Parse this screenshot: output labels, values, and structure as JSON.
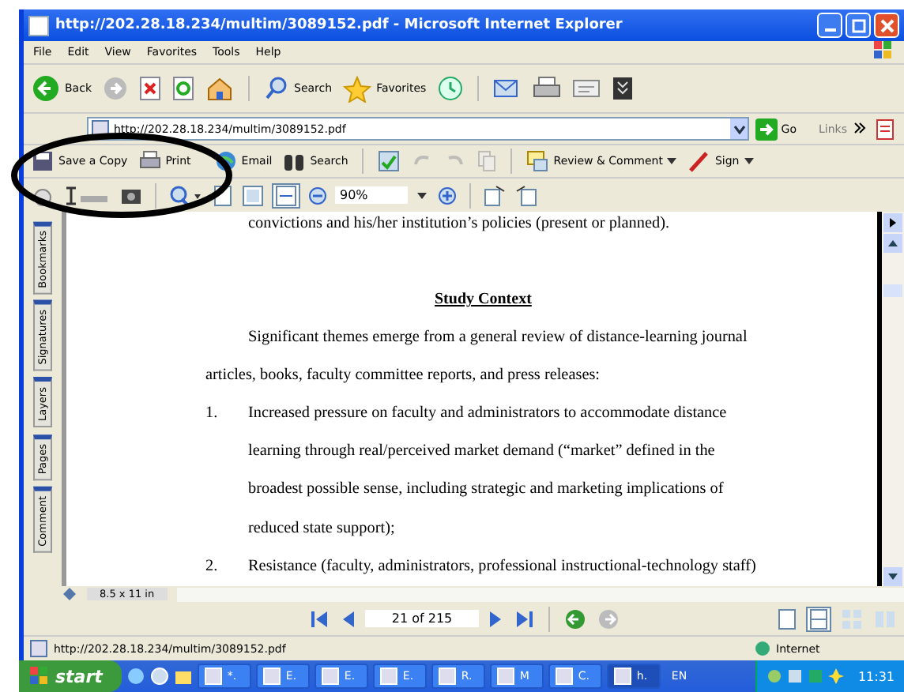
{
  "window": {
    "title": "http://202.28.18.234/multim/3089152.pdf - Microsoft Internet Explorer"
  },
  "menu": [
    "File",
    "Edit",
    "View",
    "Favorites",
    "Tools",
    "Help"
  ],
  "nav_toolbar": {
    "back": "Back",
    "search": "Search",
    "favorites": "Favorites"
  },
  "address": {
    "url": "http://202.28.18.234/multim/3089152.pdf",
    "go": "Go",
    "links": "Links"
  },
  "pdf_toolbar": [
    "Save a Copy",
    "Print",
    "Email",
    "Search",
    "Review & Comment",
    "Sign"
  ],
  "zoom": "90%",
  "side_tabs": [
    "Bookmarks",
    "Signatures",
    "Layers",
    "Pages",
    "Comment"
  ],
  "document": [
    {
      "kind": "indent",
      "text": "convictions and his/her institution’s policies (present or planned)."
    },
    {
      "kind": "heading",
      "text": "Study Context"
    },
    {
      "kind": "indent",
      "text": "Significant themes emerge from a general review of distance-learning journal"
    },
    {
      "kind": "line",
      "text": "articles, books, faculty committee reports, and press releases:"
    },
    {
      "kind": "item",
      "number": "1.",
      "text": "Increased pressure on faculty and administrators to accommodate distance"
    },
    {
      "kind": "indent",
      "text": "learning through real/perceived market demand (“market” defined in the"
    },
    {
      "kind": "indent",
      "text": "broadest possible sense, including strategic and marketing implications of"
    },
    {
      "kind": "indent",
      "text": "reduced state support);"
    },
    {
      "kind": "item",
      "number": "2.",
      "text": "Resistance (faculty, administrators, professional instructional-technology staff)"
    }
  ],
  "page_size": "8.5 x 11 in",
  "page_nav": "21 of 215",
  "status": {
    "url": "http://202.28.18.234/multim/3089152.pdf",
    "zone": "Internet"
  },
  "taskbar": {
    "start": "start",
    "tasks": [
      {
        "label": "*.",
        "selected": false
      },
      {
        "label": "E.",
        "selected": false
      },
      {
        "label": "E.",
        "selected": false
      },
      {
        "label": "E.",
        "selected": false
      },
      {
        "label": "R.",
        "selected": false
      },
      {
        "label": "M",
        "selected": false
      },
      {
        "label": "C.",
        "selected": false
      },
      {
        "label": "h.",
        "selected": true
      }
    ],
    "lang": "EN",
    "clock": "11:31"
  }
}
